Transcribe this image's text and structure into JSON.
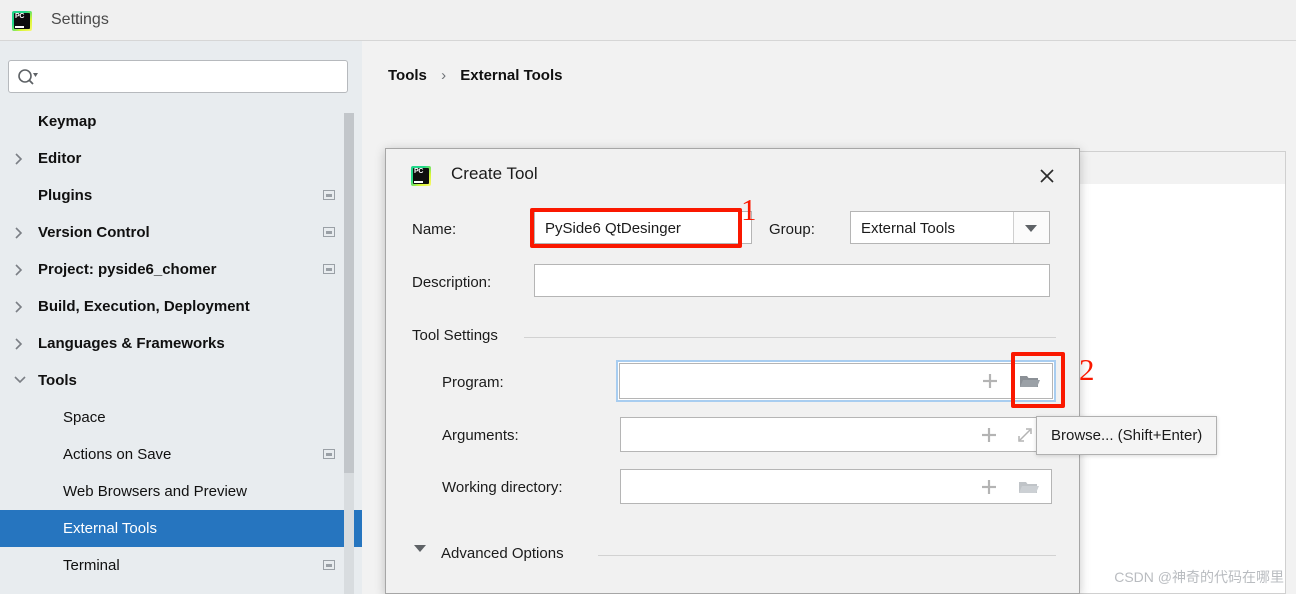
{
  "window": {
    "title": "Settings",
    "app_icon": "pycharm-icon"
  },
  "sidebar": {
    "search": {
      "value": "",
      "placeholder": "",
      "icon": "search-icon"
    },
    "items": [
      {
        "label": "Keymap",
        "level": 0,
        "bold": true,
        "chevron": "none",
        "badge": false,
        "selected": false
      },
      {
        "label": "Editor",
        "level": 0,
        "bold": true,
        "chevron": "right",
        "badge": false,
        "selected": false
      },
      {
        "label": "Plugins",
        "level": 0,
        "bold": true,
        "chevron": "none",
        "badge": true,
        "selected": false
      },
      {
        "label": "Version Control",
        "level": 0,
        "bold": true,
        "chevron": "right",
        "badge": true,
        "selected": false
      },
      {
        "label": "Project: pyside6_chomer",
        "level": 0,
        "bold": true,
        "chevron": "right",
        "badge": true,
        "selected": false
      },
      {
        "label": "Build, Execution, Deployment",
        "level": 0,
        "bold": true,
        "chevron": "right",
        "badge": false,
        "selected": false
      },
      {
        "label": "Languages & Frameworks",
        "level": 0,
        "bold": true,
        "chevron": "right",
        "badge": false,
        "selected": false
      },
      {
        "label": "Tools",
        "level": 0,
        "bold": true,
        "chevron": "down",
        "badge": false,
        "selected": false
      },
      {
        "label": "Space",
        "level": 1,
        "bold": false,
        "chevron": "none",
        "badge": false,
        "selected": false
      },
      {
        "label": "Actions on Save",
        "level": 1,
        "bold": false,
        "chevron": "none",
        "badge": true,
        "selected": false
      },
      {
        "label": "Web Browsers and Preview",
        "level": 1,
        "bold": false,
        "chevron": "none",
        "badge": false,
        "selected": false
      },
      {
        "label": "External Tools",
        "level": 1,
        "bold": false,
        "chevron": "none",
        "badge": false,
        "selected": true
      },
      {
        "label": "Terminal",
        "level": 1,
        "bold": false,
        "chevron": "none",
        "badge": true,
        "selected": false
      }
    ]
  },
  "main": {
    "breadcrumb": {
      "root": "Tools",
      "separator": "›",
      "current": "External Tools"
    },
    "toolbar": [
      {
        "name": "add-tool-button",
        "icon": "plus-icon",
        "enabled": true,
        "active": true
      },
      {
        "name": "remove-tool-button",
        "icon": "minus-icon",
        "enabled": false,
        "active": false
      },
      {
        "name": "edit-tool-button",
        "icon": "pencil-icon",
        "enabled": false,
        "active": false
      },
      {
        "name": "move-up-button",
        "icon": "arrow-up-icon",
        "enabled": false,
        "active": false
      },
      {
        "name": "move-down-button",
        "icon": "arrow-down-icon",
        "enabled": false,
        "active": false
      },
      {
        "name": "copy-tool-button",
        "icon": "copy-icon",
        "enabled": false,
        "active": false
      }
    ]
  },
  "dialog": {
    "title": "Create Tool",
    "icon": "pycharm-icon",
    "close_icon": "close-icon",
    "fields": {
      "name_label": "Name:",
      "name_value": "PySide6 QtDesinger",
      "group_label": "Group:",
      "group_value": "External Tools",
      "description_label": "Description:",
      "description_value": "",
      "program_label": "Program:",
      "program_value": "",
      "arguments_label": "Arguments:",
      "arguments_value": "",
      "working_directory_label": "Working directory:",
      "working_directory_value": ""
    },
    "sections": {
      "tool_settings": "Tool Settings",
      "advanced_options": "Advanced Options"
    }
  },
  "tooltip": {
    "text": "Browse... (Shift+Enter)"
  },
  "annotations": [
    {
      "number": "1",
      "target": "name-field"
    },
    {
      "number": "2",
      "target": "program-browse-button"
    }
  ],
  "watermark": "CSDN @神奇的代码在哪里",
  "colors": {
    "accent_selection": "#2675bf",
    "sidebar_bg": "#e8ecef",
    "panel_bg": "#f2f2f2",
    "annotation_red": "#fa1800",
    "focus_blue": "#a8cdf0"
  }
}
